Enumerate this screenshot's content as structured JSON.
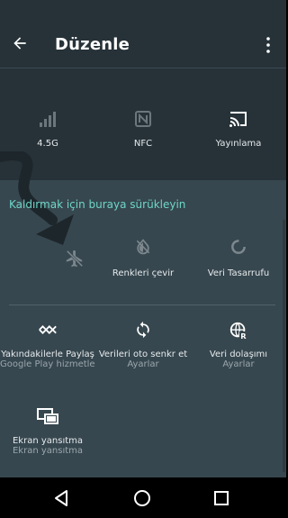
{
  "appbar": {
    "title": "Düzenle"
  },
  "hint": "Kaldırmak için buraya sürükleyin",
  "top_tiles": [
    {
      "label": "4.5G",
      "icon": "signal-icon"
    },
    {
      "label": "NFC",
      "icon": "nfc-icon"
    },
    {
      "label": "Yayınlama",
      "icon": "cast-icon"
    }
  ],
  "row1_tiles": [
    {
      "label": "",
      "icon": "airplane-mode-icon"
    },
    {
      "label": "Renkleri çevir",
      "icon": "invert-colors-icon"
    },
    {
      "label": "Veri Tasarrufu",
      "icon": "data-saver-icon"
    }
  ],
  "row2_tiles": [
    {
      "label": "Yakındakilerle Paylaş",
      "sub": "Google Play hizmetleri",
      "icon": "nearby-share-icon"
    },
    {
      "label": "Verileri oto senkr et",
      "sub": "Ayarlar",
      "icon": "sync-icon"
    },
    {
      "label": "Veri dolaşımı",
      "sub": "Ayarlar",
      "icon": "roaming-icon"
    }
  ],
  "row3_tiles": [
    {
      "label": "Ekran yansıtma",
      "sub": "Ekran yansıtma",
      "icon": "screen-mirror-icon"
    }
  ]
}
